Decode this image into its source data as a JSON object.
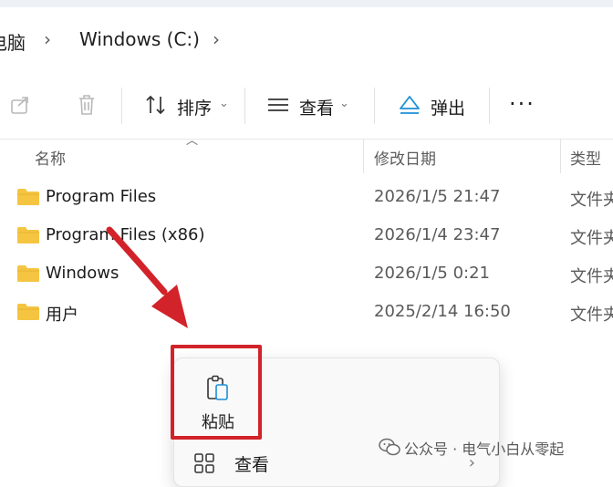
{
  "breadcrumb": {
    "prev_label": "电脑",
    "current_label": "Windows (C:)"
  },
  "toolbar": {
    "sort_label": "排序",
    "view_label": "查看",
    "eject_label": "弹出",
    "more_label": "···"
  },
  "columns": {
    "name": "名称",
    "date": "修改日期",
    "type": "类型"
  },
  "files": [
    {
      "name": "Program Files",
      "date": "2026/1/5 21:47",
      "type": "文件夹"
    },
    {
      "name": "Program Files (x86)",
      "date": "2026/1/4 23:47",
      "type": "文件夹"
    },
    {
      "name": "Windows",
      "date": "2026/1/5 0:21",
      "type": "文件夹"
    },
    {
      "name": "用户",
      "date": "2025/2/14 16:50",
      "type": "文件夹"
    }
  ],
  "context_menu": {
    "paste_label": "粘贴",
    "view_label": "查看"
  },
  "watermark": {
    "text": "公众号 · 电气小白从零起"
  },
  "colors": {
    "highlight": "#d2232a",
    "folder": "#f5c542",
    "eject_icon": "#1a8fd9"
  }
}
